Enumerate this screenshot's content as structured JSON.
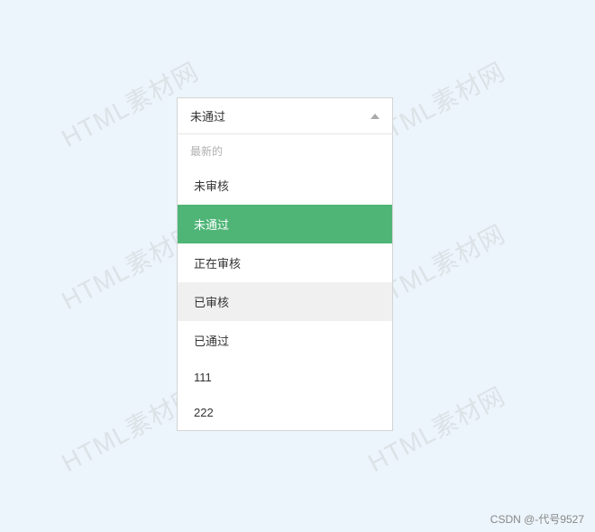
{
  "watermark_text": "HTML素材网",
  "attribution": "CSDN @-代号9527",
  "dropdown": {
    "selected_value": "未通过",
    "group_label": "最新的",
    "options": [
      {
        "label": "未审核",
        "state": "normal"
      },
      {
        "label": "未通过",
        "state": "selected"
      },
      {
        "label": "正在审核",
        "state": "normal"
      },
      {
        "label": "已审核",
        "state": "hover"
      },
      {
        "label": "已通过",
        "state": "normal"
      },
      {
        "label": "111",
        "state": "normal"
      },
      {
        "label": "222",
        "state": "normal"
      }
    ]
  }
}
